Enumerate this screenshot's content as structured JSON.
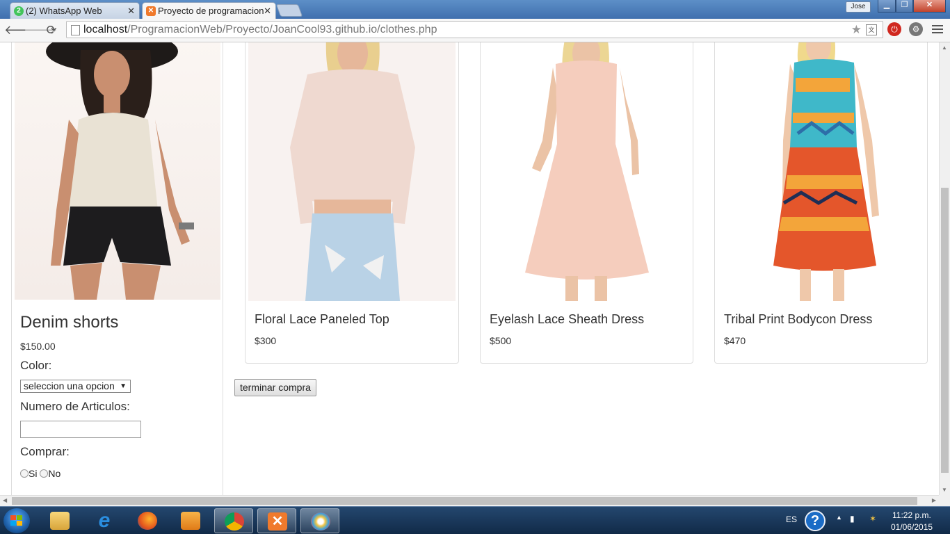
{
  "browser": {
    "tabs": [
      {
        "label": "(2) WhatsApp Web",
        "badge": "2"
      },
      {
        "label": "Proyecto de programacion"
      }
    ],
    "user_badge": "Jose",
    "url_host": "localhost",
    "url_path": "/ProgramacionWeb/Proyecto/JoanCool93.github.io/clothes.php"
  },
  "sidebar": {
    "product_name": "Denim shorts",
    "price": "$150.00",
    "color_label": "Color:",
    "color_select_value": "seleccion una opcion",
    "quantity_label": "Numero de Articulos:",
    "quantity_value": "",
    "buy_label": "Comprar:",
    "yes_label": "Si",
    "no_label": "No"
  },
  "products": [
    {
      "name": "Floral Lace Paneled Top",
      "price": "$300"
    },
    {
      "name": "Eyelash Lace Sheath Dress",
      "price": "$500"
    },
    {
      "name": "Tribal Print Bodycon Dress",
      "price": "$470"
    }
  ],
  "finish_button": "terminar compra",
  "taskbar": {
    "lang": "ES",
    "time": "11:22 p.m.",
    "date": "01/06/2015"
  }
}
